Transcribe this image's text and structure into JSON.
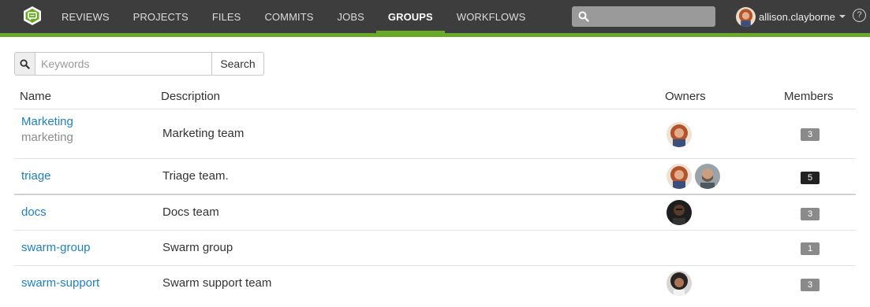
{
  "nav": {
    "items": [
      "REVIEWS",
      "PROJECTS",
      "FILES",
      "COMMITS",
      "JOBS",
      "GROUPS",
      "WORKFLOWS"
    ],
    "active": "GROUPS",
    "search_placeholder": "",
    "user": "allison.clayborne",
    "help": "?"
  },
  "filter": {
    "placeholder": "Keywords",
    "button": "Search"
  },
  "table": {
    "headers": {
      "name": "Name",
      "description": "Description",
      "owners": "Owners",
      "members": "Members"
    },
    "rows": [
      {
        "name": "Marketing",
        "id": "marketing",
        "description": "Marketing team",
        "owners": [
          "allison"
        ],
        "members": "3"
      },
      {
        "name": "triage",
        "description": "Triage team.",
        "owners": [
          "allison",
          "bearded-man"
        ],
        "members": "5"
      },
      {
        "name": "docs",
        "description": "Docs team",
        "owners": [
          "dark-portrait"
        ],
        "members": "3"
      },
      {
        "name": "swarm-group",
        "description": "Swarm group",
        "owners": [],
        "members": "1"
      },
      {
        "name": "swarm-support",
        "description": "Swarm support team",
        "owners": [
          "curly-woman"
        ],
        "members": "3"
      }
    ]
  },
  "colors": {
    "nav_bg": "#3d3d3d",
    "accent": "#6aa827",
    "link": "#1f80c0",
    "badge": "#8a8a8a",
    "badge_dark": "#222222"
  }
}
